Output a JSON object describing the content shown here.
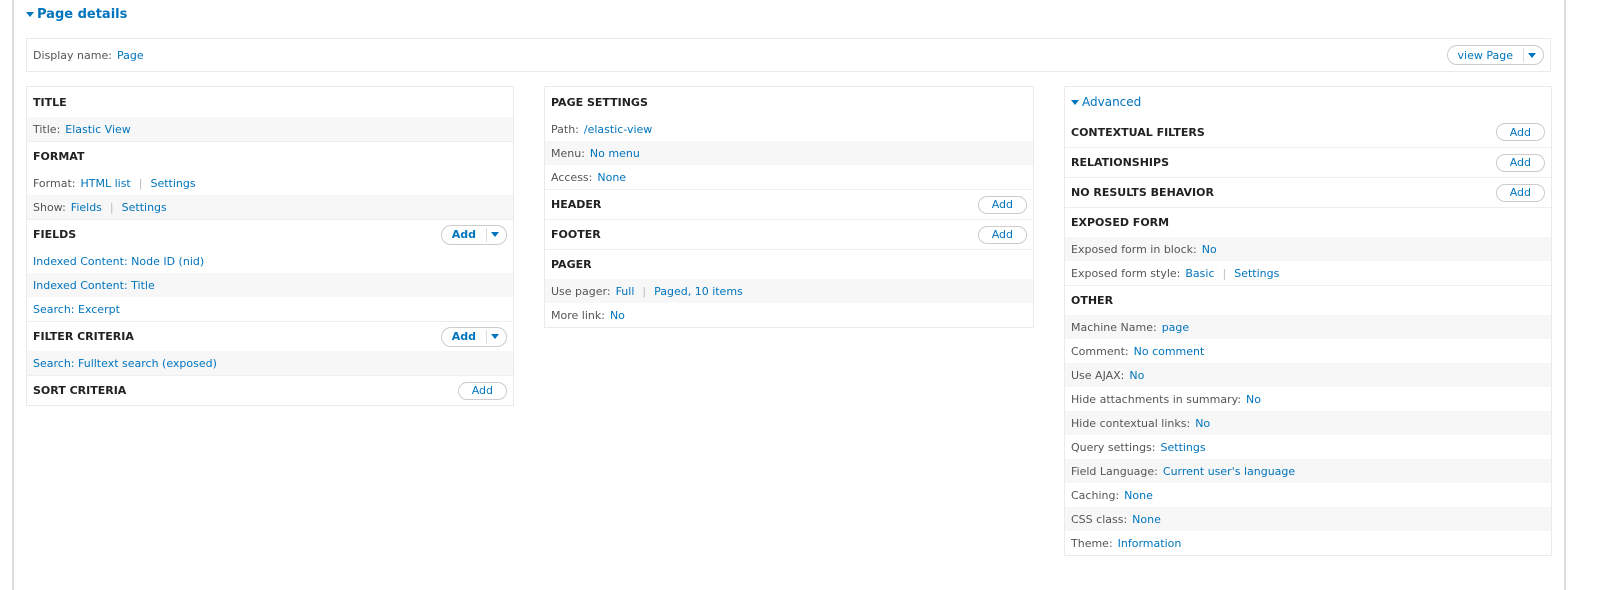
{
  "page_details": "Page details",
  "display": {
    "label": "Display name:",
    "value": "Page",
    "view_button": "view Page"
  },
  "left": {
    "title_h": "TITLE",
    "title_k": "Title:",
    "title_v": "Elastic View",
    "format_h": "FORMAT",
    "format_k": "Format:",
    "format_v": "HTML list",
    "format_s": "Settings",
    "show_k": "Show:",
    "show_v": "Fields",
    "show_s": "Settings",
    "fields_h": "FIELDS",
    "fields": [
      "Indexed Content: Node ID (nid)",
      "Indexed Content: Title",
      "Search: Excerpt"
    ],
    "filter_h": "FILTER CRITERIA",
    "filters": [
      "Search: Fulltext search (exposed)"
    ],
    "sort_h": "SORT CRITERIA"
  },
  "middle": {
    "ps_h": "PAGE SETTINGS",
    "path_k": "Path:",
    "path_v": "/elastic-view",
    "menu_k": "Menu:",
    "menu_v": "No menu",
    "access_k": "Access:",
    "access_v": "None",
    "header_h": "HEADER",
    "footer_h": "FOOTER",
    "pager_h": "PAGER",
    "pager_k": "Use pager:",
    "pager_v": "Full",
    "pager_s": "Paged, 10 items",
    "more_k": "More link:",
    "more_v": "No"
  },
  "right": {
    "advanced": "Advanced",
    "ctx_h": "CONTEXTUAL FILTERS",
    "rel_h": "RELATIONSHIPS",
    "nr_h": "NO RESULTS BEHAVIOR",
    "ef_h": "EXPOSED FORM",
    "efb_k": "Exposed form in block:",
    "efb_v": "No",
    "efs_k": "Exposed form style:",
    "efs_v": "Basic",
    "efs_s": "Settings",
    "other_h": "OTHER",
    "other": [
      {
        "k": "Machine Name:",
        "v": "page"
      },
      {
        "k": "Comment:",
        "v": "No comment"
      },
      {
        "k": "Use AJAX:",
        "v": "No"
      },
      {
        "k": "Hide attachments in summary:",
        "v": "No"
      },
      {
        "k": "Hide contextual links:",
        "v": "No"
      },
      {
        "k": "Query settings:",
        "v": "Settings"
      },
      {
        "k": "Field Language:",
        "v": "Current user's language"
      },
      {
        "k": "Caching:",
        "v": "None"
      },
      {
        "k": "CSS class:",
        "v": "None"
      },
      {
        "k": "Theme:",
        "v": "Information"
      }
    ]
  },
  "add_label": "Add"
}
